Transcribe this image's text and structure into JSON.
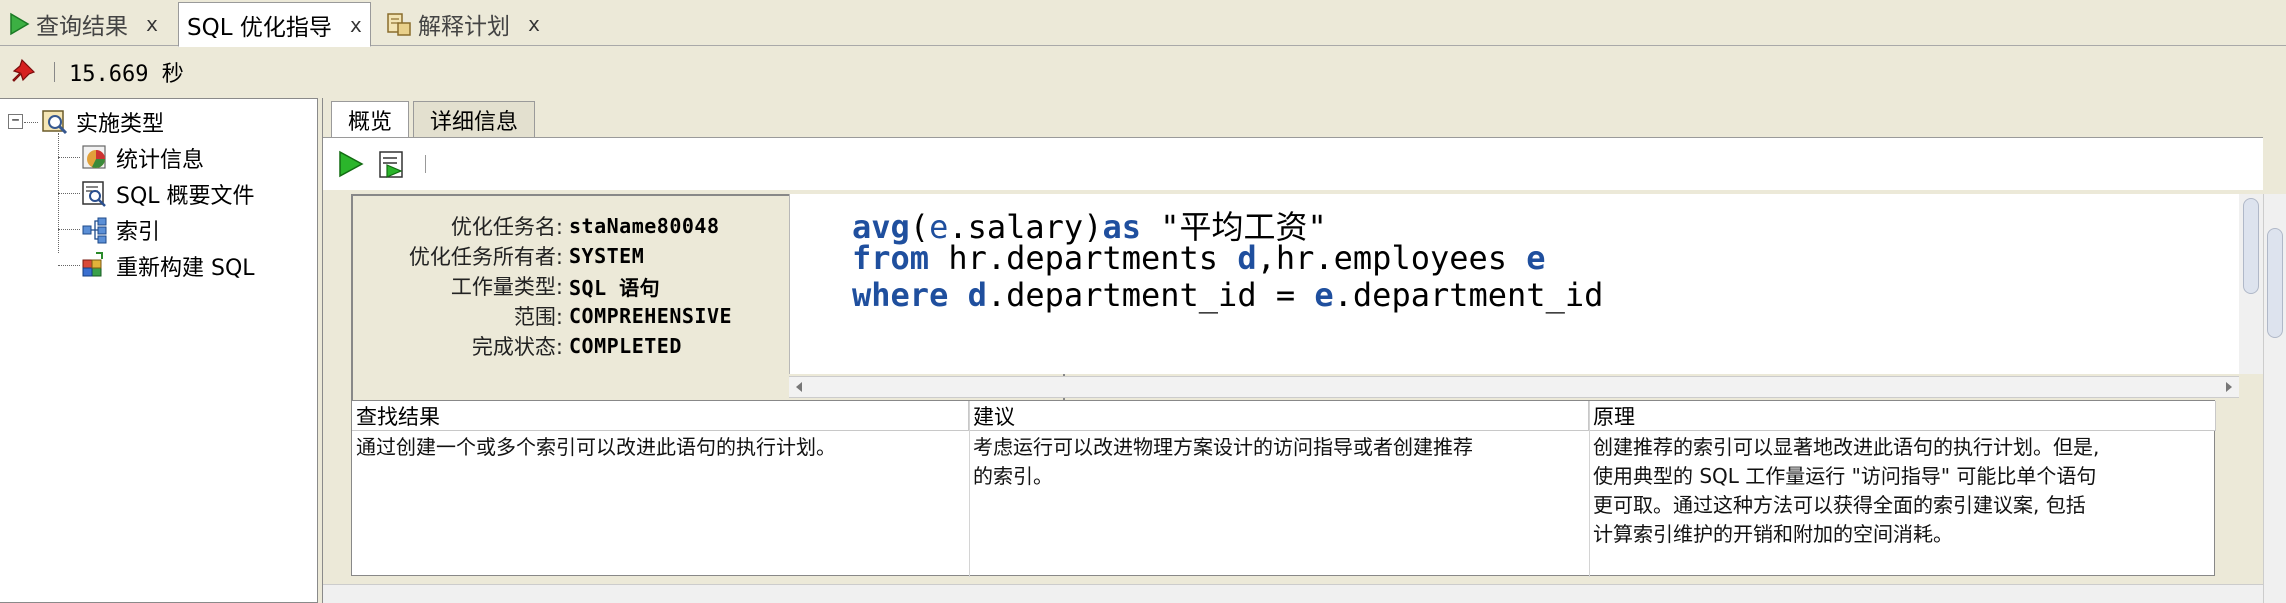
{
  "tabs": [
    {
      "label": "查询结果",
      "icon": "run-icon",
      "close": "x",
      "active": false
    },
    {
      "label": "SQL 优化指导",
      "icon": "",
      "close": "x",
      "active": true
    },
    {
      "label": "解释计划",
      "icon": "plan-icon",
      "close": "x",
      "active": false
    }
  ],
  "status": {
    "elapsed": "15.669 秒",
    "pin_icon": "pin-icon"
  },
  "tree": {
    "root": {
      "label": "实施类型",
      "expander": "−"
    },
    "children": [
      {
        "label": "统计信息",
        "icon": "statistics-icon"
      },
      {
        "label": "SQL 概要文件",
        "icon": "sql-profile-icon"
      },
      {
        "label": "索引",
        "icon": "index-icon"
      },
      {
        "label": "重新构建 SQL",
        "icon": "rebuild-sql-icon"
      }
    ]
  },
  "subtabs": [
    {
      "label": "概览",
      "active": true
    },
    {
      "label": "详细信息",
      "active": false
    }
  ],
  "summary": {
    "rows": [
      {
        "key": "优化任务名:",
        "value": "staName80048"
      },
      {
        "key": "优化任务所有者:",
        "value": "SYSTEM"
      },
      {
        "key": "工作量类型:",
        "value": "SQL 语句"
      },
      {
        "key": "范围:",
        "value": "COMPREHENSIVE"
      },
      {
        "key": "完成状态:",
        "value": "COMPLETED"
      }
    ]
  },
  "sql": {
    "line1": {
      "kw1": "avg",
      "p1": "(",
      "alias1": "e",
      "p2": ".salary)",
      "kw2": "as",
      "p3": " \"平均工资\""
    },
    "line2": {
      "kw1": "from",
      "p1": " hr.departments ",
      "alias1": "d",
      "p2": ",hr.employees ",
      "alias2": "e"
    },
    "line3": {
      "kw1": "where",
      "p0": " ",
      "alias1": "d",
      "p1": ".department_id = ",
      "alias2": "e",
      "p2": ".department_id"
    }
  },
  "table": {
    "headers": [
      "查找结果",
      "建议",
      "原理"
    ],
    "row": [
      [
        "通过创建一个或多个索引可以改进此语句的执行计划。"
      ],
      [
        "考虑运行可以改进物理方案设计的访问指导或者创建推荐",
        "的索引。"
      ],
      [
        "创建推荐的索引可以显著地改进此语句的执行计划。但是,",
        "使用典型的 SQL 工作量运行 \"访问指导\" 可能比单个语句",
        "更可取。通过这种方法可以获得全面的索引建议案, 包括",
        "计算索引维护的开销和附加的空间消耗。"
      ]
    ]
  },
  "colors": {
    "keyword": "#1f4f9e",
    "run_green": "#22a822"
  }
}
